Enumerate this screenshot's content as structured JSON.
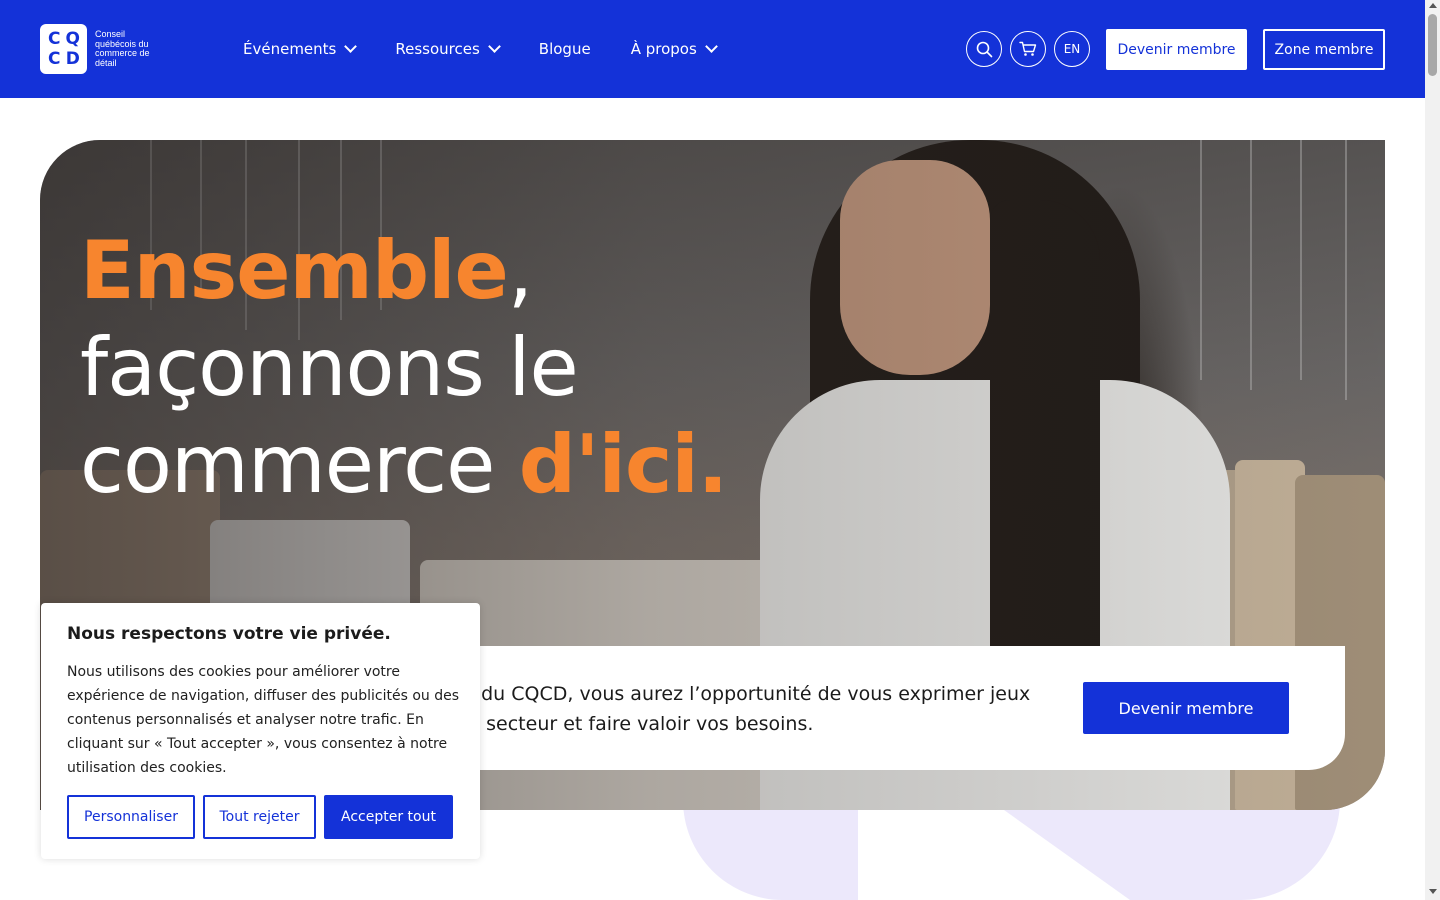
{
  "header": {
    "logo_letters": [
      "C",
      "Q",
      "C",
      "D"
    ],
    "logo_text": "Conseil québécois du commerce de détail",
    "nav": [
      {
        "label": "Événements",
        "has_dropdown": true
      },
      {
        "label": "Ressources",
        "has_dropdown": true
      },
      {
        "label": "Blogue",
        "has_dropdown": false
      },
      {
        "label": "À propos",
        "has_dropdown": true
      }
    ],
    "lang_label": "EN",
    "become_member_label": "Devenir membre",
    "member_zone_label": "Zone membre",
    "search_icon": "search-icon",
    "cart_icon": "cart-icon"
  },
  "hero": {
    "headline_accent_1": "Ensemble",
    "headline_comma": ",",
    "headline_line2": "façonnons le",
    "headline_line3": "commerce ",
    "headline_accent_2": "d'ici.",
    "card_text": "re du CQCD, vous aurez l’opportunité de vous exprimer jeux du secteur et faire valoir vos besoins.",
    "card_button": "Devenir membre"
  },
  "cookie": {
    "title": "Nous respectons votre vie privée.",
    "body": "Nous utilisons des cookies pour améliorer votre expérience de navigation, diffuser des publicités ou des contenus personnalisés et analyser notre trafic. En cliquant sur « Tout accepter », vous consentez à notre utilisation des cookies.",
    "customize_label": "Personnaliser",
    "reject_label": "Tout rejeter",
    "accept_label": "Accepter tout"
  },
  "colors": {
    "brand_blue": "#1432d8",
    "accent_orange": "#f7852e",
    "lavender": "#ece8fb"
  }
}
